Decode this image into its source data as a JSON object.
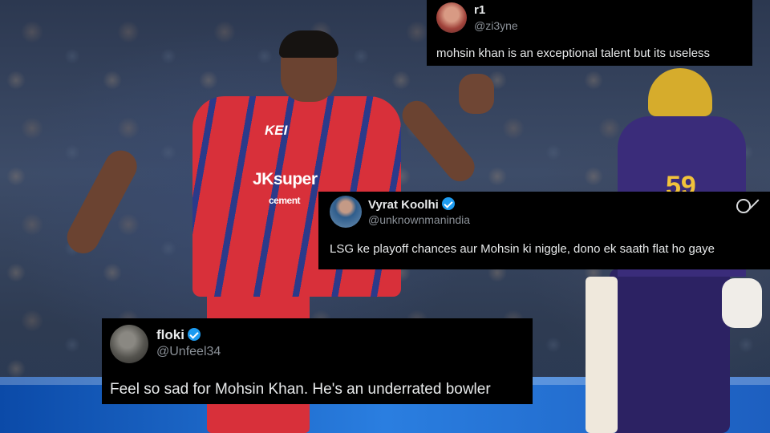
{
  "tweets": [
    {
      "name": "r1",
      "handle": "@zi3yne",
      "text": "mohsin khan is an exceptional talent but its useless",
      "verified": false
    },
    {
      "name": "Vyrat Koolhi",
      "handle": "@unknownmanindia",
      "text": "LSG ke playoff chances aur Mohsin ki niggle, dono ek saath flat ho gaye",
      "verified": true
    },
    {
      "name": "floki",
      "handle": "@Unfeel34",
      "text": "Feel so sad for Mohsin Khan. He's an underrated bowler",
      "verified": true
    }
  ],
  "photo": {
    "jersey_sponsor": "JKsuper",
    "jersey_sponsor_sub": "cement",
    "jersey_top": "KEI",
    "batsman_number": "59"
  },
  "colors": {
    "card_bg": "#000000",
    "text": "#e7e9ea",
    "handle": "#8b9198",
    "verified": "#1d9bf0"
  }
}
